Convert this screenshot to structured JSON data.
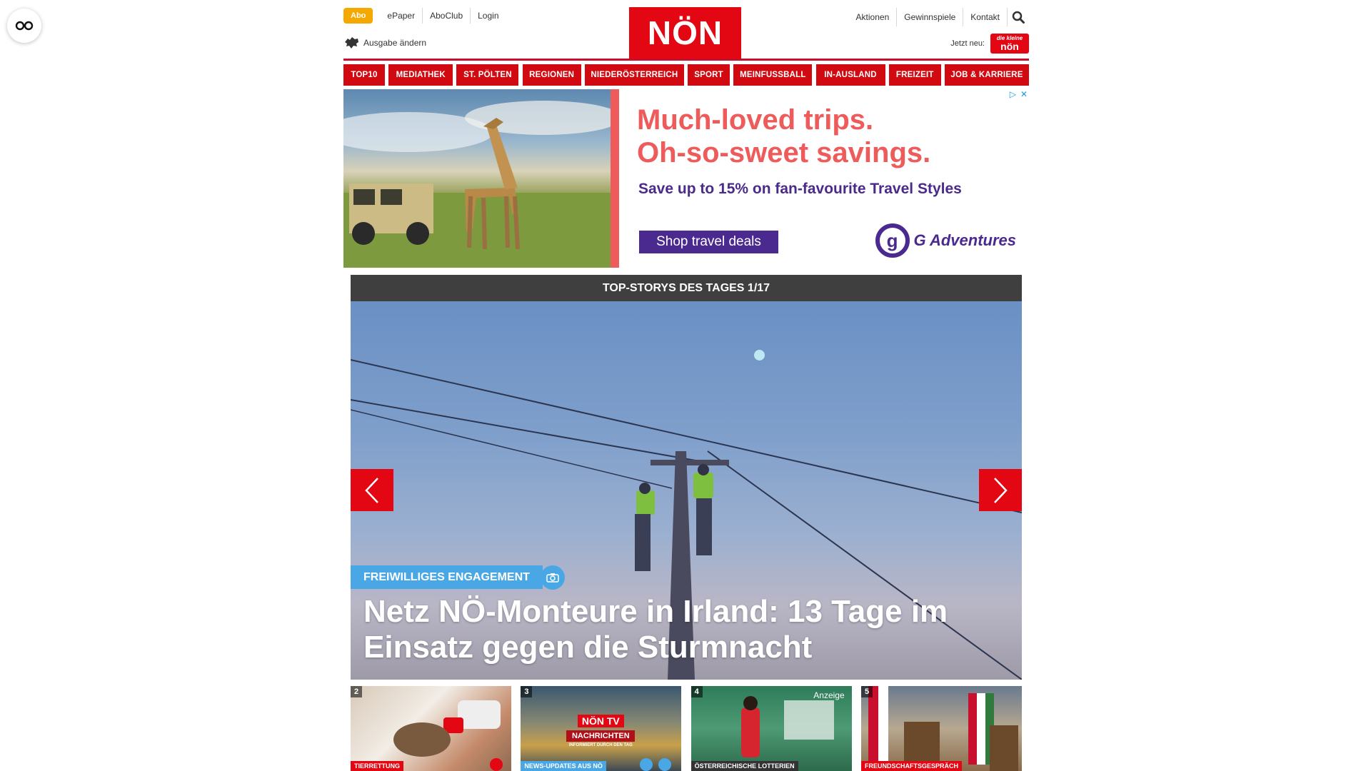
{
  "header": {
    "abo": "Abo",
    "top_links": [
      "ePaper",
      "AboClub",
      "Login"
    ],
    "edition_label": "Ausgabe ändern",
    "logo": "NÖN",
    "right_links": [
      "Aktionen",
      "Gewinnspiele",
      "Kontakt"
    ],
    "jetzt_neu": "Jetzt neu:",
    "kleine_line1": "die kleine",
    "kleine_line2": "nön"
  },
  "nav": [
    "TOP10",
    "MEDIATHEK",
    "ST. PÖLTEN",
    "REGIONEN",
    "NIEDERÖSTERREICH",
    "SPORT",
    "MEINFUSSBALL",
    "IN-AUSLAND",
    "FREIZEIT",
    "JOB & KARRIERE"
  ],
  "ad": {
    "headline1": "Much-loved trips.",
    "headline2": "Oh-so-sweet savings.",
    "subline": "Save up to 15% on fan-favourite Travel Styles",
    "cta": "Shop travel deals",
    "brand": "G Adventures"
  },
  "top_stories": {
    "header": "TOP-STORYS DES TAGES 1/17",
    "category": "FREIWILLIGES ENGAGEMENT",
    "title_line1": "Netz NÖ-Monteure in Irland: 13 Tage im",
    "title_line2": "Einsatz gegen die Sturmnacht"
  },
  "thumbs": [
    {
      "num": "2",
      "tag": "TIERRETTUNG",
      "tag_color": "#e30613"
    },
    {
      "num": "3",
      "tag": "NEWS-UPDATES AUS NÖ",
      "tag_color": "#49a7e6",
      "tv1": "NÖN TV",
      "tv2": "NACHRICHTEN",
      "tv3": "INFORMIERT DURCH DEN TAG"
    },
    {
      "num": "4",
      "tag": "ÖSTERREICHISCHE LOTTERIEN",
      "tag_color": "#333333",
      "anzeige": "Anzeige"
    },
    {
      "num": "5",
      "tag": "FREUNDSCHAFTSGESPRÄCH",
      "tag_color": "#e30613"
    }
  ],
  "colors": {
    "brand_red": "#e30613",
    "accent_blue": "#49a7e6",
    "abo_orange": "#f5a800",
    "ad_purple": "#4b2a90",
    "ad_coral": "#ee5b5b"
  }
}
